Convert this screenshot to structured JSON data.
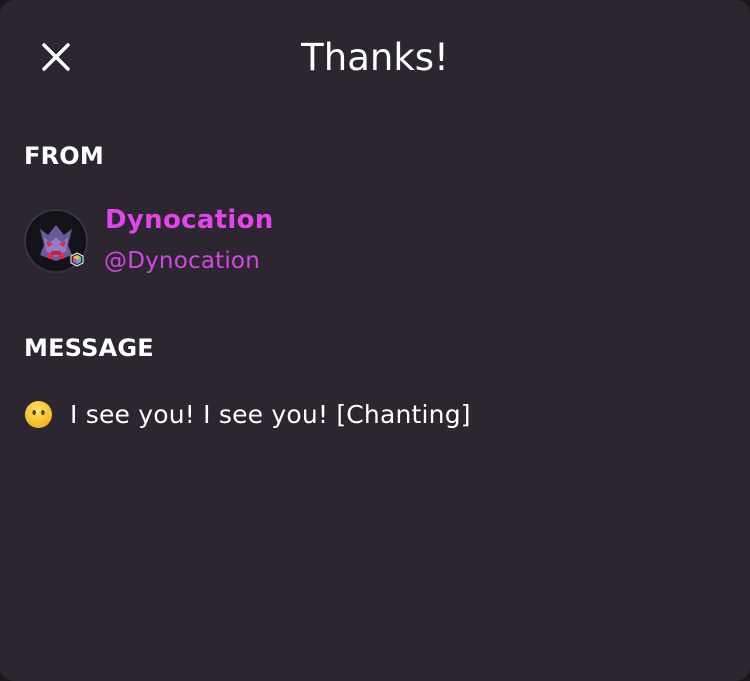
{
  "modal": {
    "title": "Thanks!",
    "close_icon": "close-icon"
  },
  "from": {
    "label": "FROM",
    "display_name": "Dynocation",
    "handle": "@Dynocation"
  },
  "message": {
    "label": "MESSAGE",
    "emoji_icon": "no-mouth-face-icon",
    "text": "I see you! I see you! [Chanting]"
  },
  "colors": {
    "background": "#2b2630",
    "username": "#e245ea",
    "text": "#ffffff"
  }
}
